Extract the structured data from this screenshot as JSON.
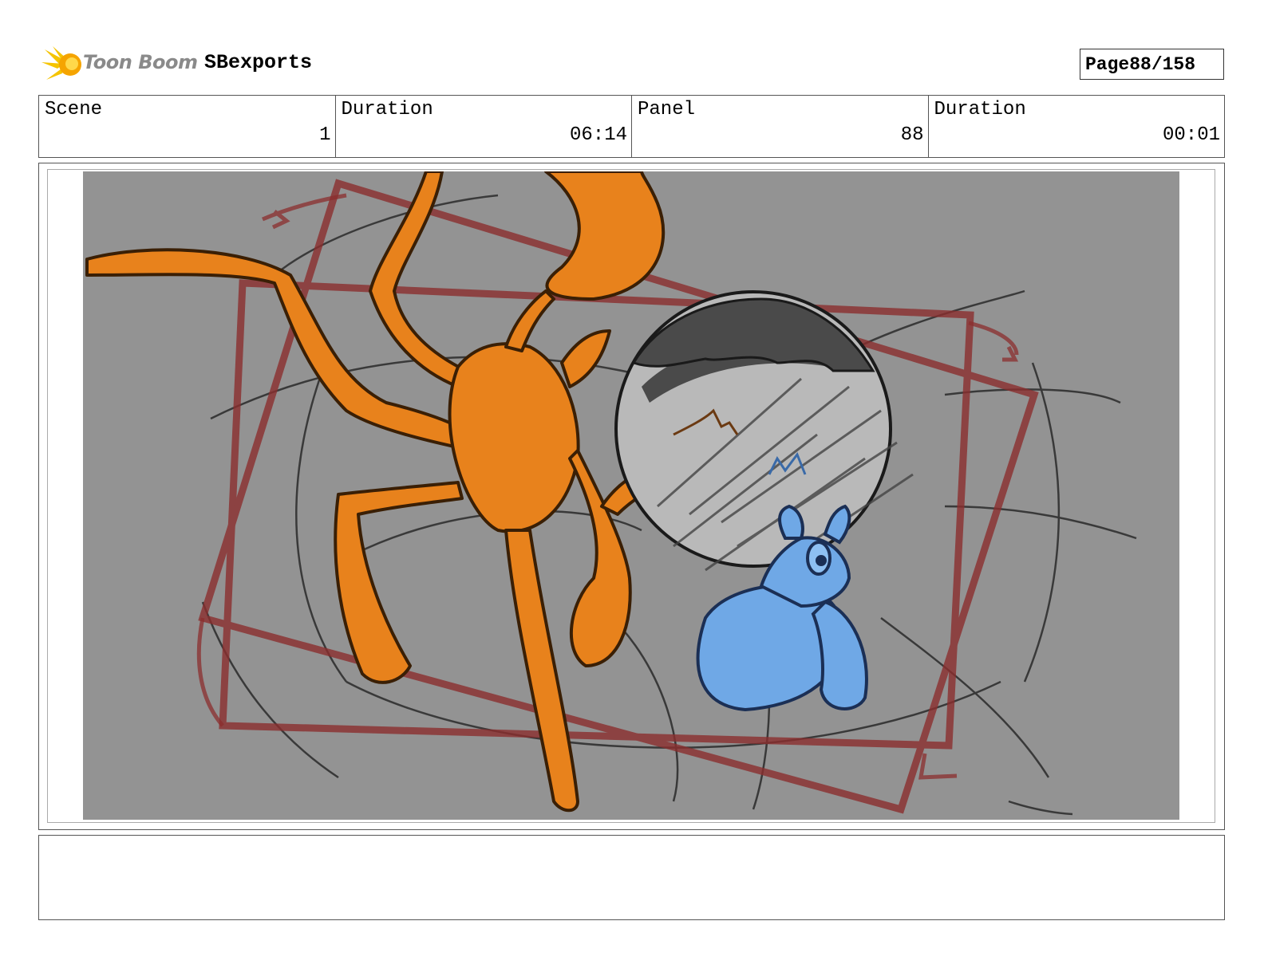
{
  "header": {
    "logo_text": "Toon Boom",
    "project_name": "SBexports",
    "page_label": "Page",
    "page_value": "88/158"
  },
  "info": {
    "scene_label": "Scene",
    "scene_value": "1",
    "scene_duration_label": "Duration",
    "scene_duration_value": "06:14",
    "panel_label": "Panel",
    "panel_value": "88",
    "panel_duration_label": "Duration",
    "panel_duration_value": "00:01"
  },
  "notes": {
    "text": ""
  },
  "colors": {
    "background_gray": "#939393",
    "ant_orange": "#e8821c",
    "bug_blue": "#6fa8e6",
    "camera_red": "#8b2e2e",
    "sketch_line": "#2a2a2a"
  }
}
